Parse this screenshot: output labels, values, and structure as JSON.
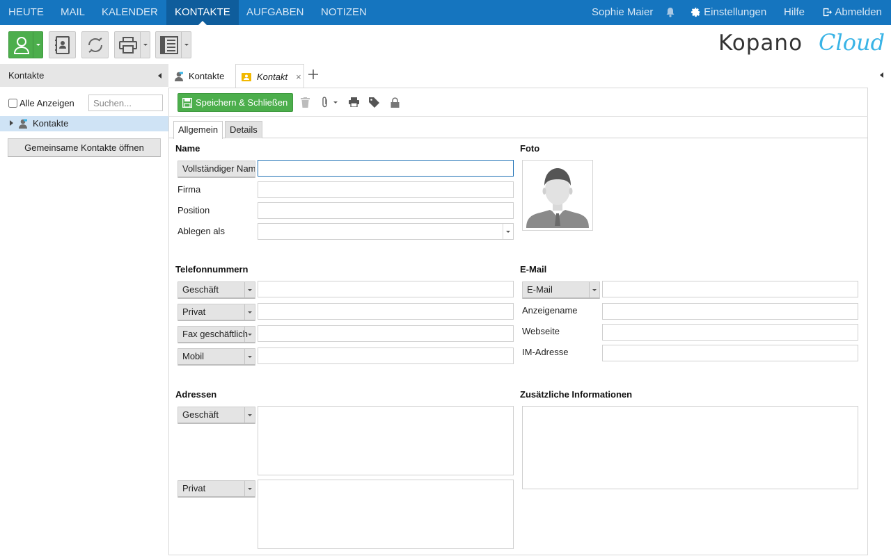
{
  "nav": {
    "items": [
      "HEUTE",
      "MAIL",
      "KALENDER",
      "KONTAKTE",
      "AUFGABEN",
      "NOTIZEN"
    ],
    "active": "KONTAKTE",
    "user": "Sophie Maier",
    "settings": "Einstellungen",
    "help": "Hilfe",
    "logout": "Abmelden"
  },
  "toolbar": {
    "buttons": [
      "new-contact-icon",
      "address-book-icon",
      "refresh-icon",
      "print-icon",
      "view-layout-icon"
    ]
  },
  "logo": {
    "text_main": "Kopano",
    "text_accent": "Cloud"
  },
  "left_panel": {
    "title": "Kontakte",
    "show_all_label": "Alle Anzeigen",
    "search_placeholder": "Suchen...",
    "tree_item": "Kontakte",
    "shared_button": "Gemeinsame Kontakte öffnen"
  },
  "tabs": [
    {
      "label": "Kontakte"
    },
    {
      "label": "Kontakt",
      "close": "×"
    }
  ],
  "form": {
    "save_label": "Speichern & Schließen",
    "subtabs": [
      "Allgemein",
      "Details"
    ],
    "name_section": "Name",
    "full_name_button": "Vollständiger Name",
    "company_label": "Firma",
    "position_label": "Position",
    "file_as_label": "Ablegen als",
    "photo_section": "Foto",
    "phone_section": "Telefonnummern",
    "phone_types": [
      "Geschäft",
      "Privat",
      "Fax geschäftlich",
      "Mobil"
    ],
    "email_section": "E-Mail",
    "email_type": "E-Mail",
    "display_name_label": "Anzeigename",
    "website_label": "Webseite",
    "im_label": "IM-Adresse",
    "address_section": "Adressen",
    "address_types": [
      "Geschäft",
      "Privat"
    ],
    "additional_section": "Zusätzliche Informationen"
  },
  "colors": {
    "nav_bg": "#1575bf",
    "nav_active": "#0f5d9c",
    "green": "#4cae4c",
    "accent": "#3ab4e6"
  }
}
